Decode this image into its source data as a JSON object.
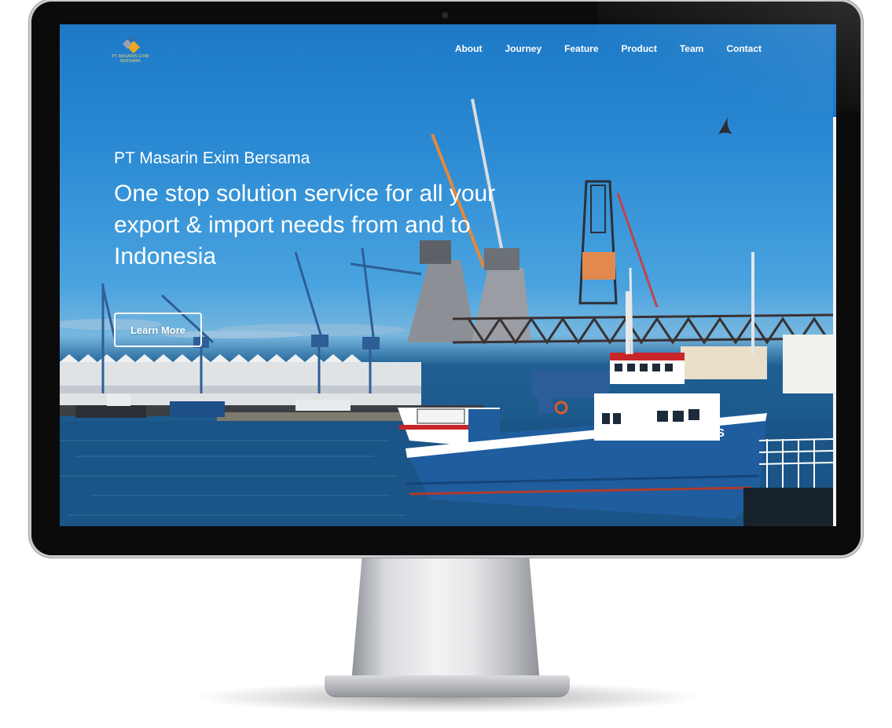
{
  "site": {
    "logo": {
      "icon": "diamond-logo-icon",
      "text": "PT MASARIN EXIM BERSAMA",
      "colors": [
        "#2f6fb5",
        "#f2a623",
        "#9aa3ad"
      ]
    },
    "nav": {
      "items": [
        {
          "label": "About"
        },
        {
          "label": "Journey"
        },
        {
          "label": "Feature"
        },
        {
          "label": "Product"
        },
        {
          "label": "Team"
        },
        {
          "label": "Contact"
        }
      ]
    },
    "hero": {
      "company": "PT Masarin Exim Bersama",
      "headline": "One stop solution service for all your export & import needs from and to Indonesia",
      "cta_label": "Learn More",
      "ship_name": "DIAS"
    }
  },
  "theme": {
    "sky": "#1d79c6",
    "water": "#184f7d",
    "hull": "#1f5d9e",
    "accent_red": "#c8262a",
    "text": "#ffffff"
  },
  "device": {
    "type": "desktop-monitor-mockup",
    "scroll_position": 0.0
  }
}
